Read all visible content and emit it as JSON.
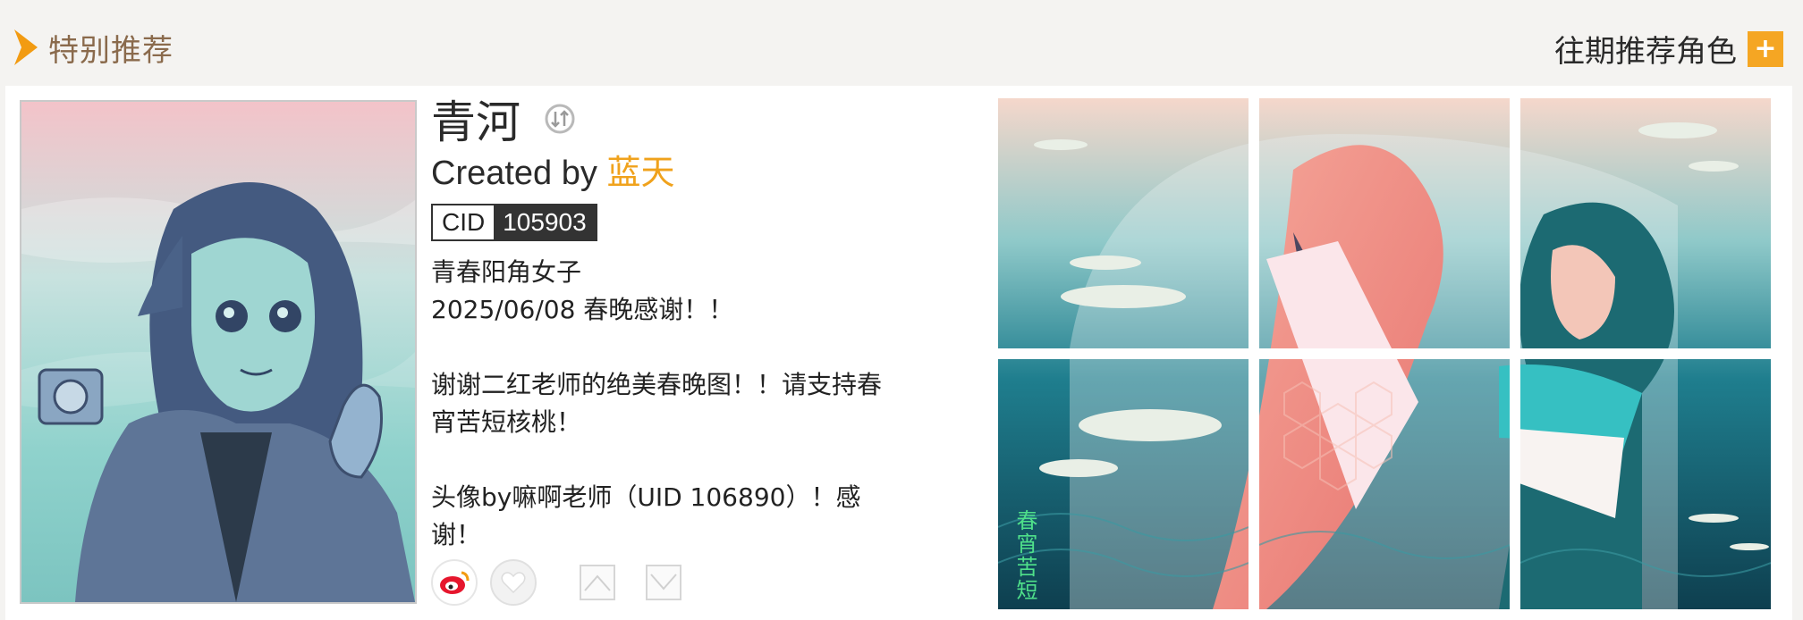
{
  "header": {
    "section_title": "特别推荐",
    "past_label": "往期推荐角色",
    "plus_label": "+"
  },
  "character": {
    "name": "青河",
    "created_prefix": "Created by ",
    "creator": "蓝天",
    "cid_label": "CID",
    "cid_value": "105903",
    "desc": [
      "青春阳角女子",
      "2025/06/08 春晚感谢！！",
      "",
      "谢谢二红老师的绝美春晚图！！请支持春宵苦短核桃！",
      "",
      "头像by嘛啊老师（UID 106890）！感谢！"
    ]
  },
  "gallery": {
    "caption": "春宵苦短"
  },
  "colors": {
    "accent": "#f5a623",
    "creator": "#f0a21c",
    "title_brown": "#8a6a4c"
  }
}
